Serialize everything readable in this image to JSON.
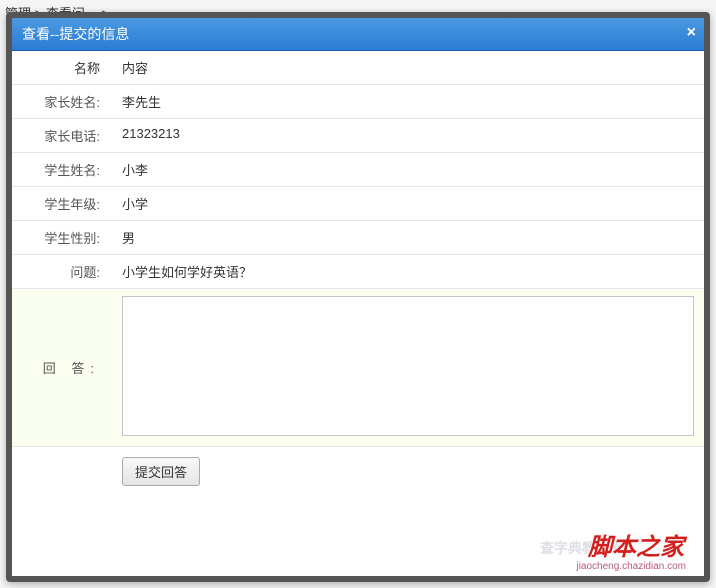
{
  "breadcrumb": "管理 > 查看问… >",
  "dialog": {
    "title": "查看--提交的信息",
    "header_label": "名称",
    "header_content": "内容",
    "rows": {
      "parent_name_label": "家长姓名:",
      "parent_name_value": "李先生",
      "parent_phone_label": "家长电话:",
      "parent_phone_value": "21323213",
      "student_name_label": "学生姓名:",
      "student_name_value": "小李",
      "student_grade_label": "学生年级:",
      "student_grade_value": "小学",
      "student_gender_label": "学生性别:",
      "student_gender_value": "男",
      "question_label": "问题:",
      "question_value": "小学生如何学好英语？",
      "answer_label": "回 答:",
      "answer_value": ""
    },
    "submit_label": "提交回答"
  },
  "watermark": {
    "text": "脚本之家",
    "url": "jiaocheng.chazidian.com"
  }
}
